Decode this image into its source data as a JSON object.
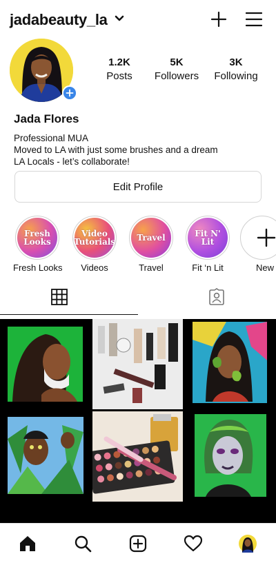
{
  "header": {
    "username": "jadabeauty_la"
  },
  "profile": {
    "name": "Jada Flores",
    "bio": [
      "Professional MUA",
      "Moved to LA with just some brushes and a dream",
      "LA Locals - let’s collaborate!"
    ],
    "stats": [
      {
        "value": "1.2K",
        "label": "Posts"
      },
      {
        "value": "5K",
        "label": "Followers"
      },
      {
        "value": "3K",
        "label": "Following"
      }
    ],
    "edit_label": "Edit Profile"
  },
  "highlights": [
    {
      "cover": "Fresh Looks",
      "label": "Fresh Looks",
      "colors": [
        "#f7a24a",
        "#d94fb0",
        "#7a4fe0"
      ]
    },
    {
      "cover": "Video Tutorials",
      "label": "Videos",
      "colors": [
        "#f5c23e",
        "#e8507a",
        "#9b4fd8"
      ]
    },
    {
      "cover": "Travel",
      "label": "Travel",
      "colors": [
        "#f7a24a",
        "#e04fa0",
        "#8a3ee0"
      ]
    },
    {
      "cover": "Fit N' Lit",
      "label": "Fit ‘n Lit",
      "colors": [
        "#f08ac0",
        "#b04fe0",
        "#7a40d8"
      ]
    },
    {
      "cover": "",
      "label": "New",
      "colors": []
    }
  ],
  "tabs": {
    "grid_icon": "grid-icon",
    "tagged_icon": "tagged-icon",
    "active": "grid"
  },
  "posts": [
    {
      "name": "post-green-face-paint",
      "bg": "#1db33a"
    },
    {
      "name": "post-makeup-products",
      "bg": "#e9e9e9"
    },
    {
      "name": "post-graffiti-leaves",
      "bg": "#2aa6c9"
    },
    {
      "name": "post-carnival-feathers",
      "bg": "#3b8a3c"
    },
    {
      "name": "post-eyeshadow-palette",
      "bg": "#efe7dc"
    },
    {
      "name": "post-green-hair-makeup",
      "bg": "#29b64a"
    }
  ],
  "nav": [
    "home-icon",
    "search-icon",
    "new-post-icon",
    "activity-heart-icon",
    "profile-avatar-icon"
  ],
  "colors": {
    "accent_blue": "#3a86e8",
    "avatar_bg": "#f2d93a",
    "grid_bg": "#000000"
  }
}
